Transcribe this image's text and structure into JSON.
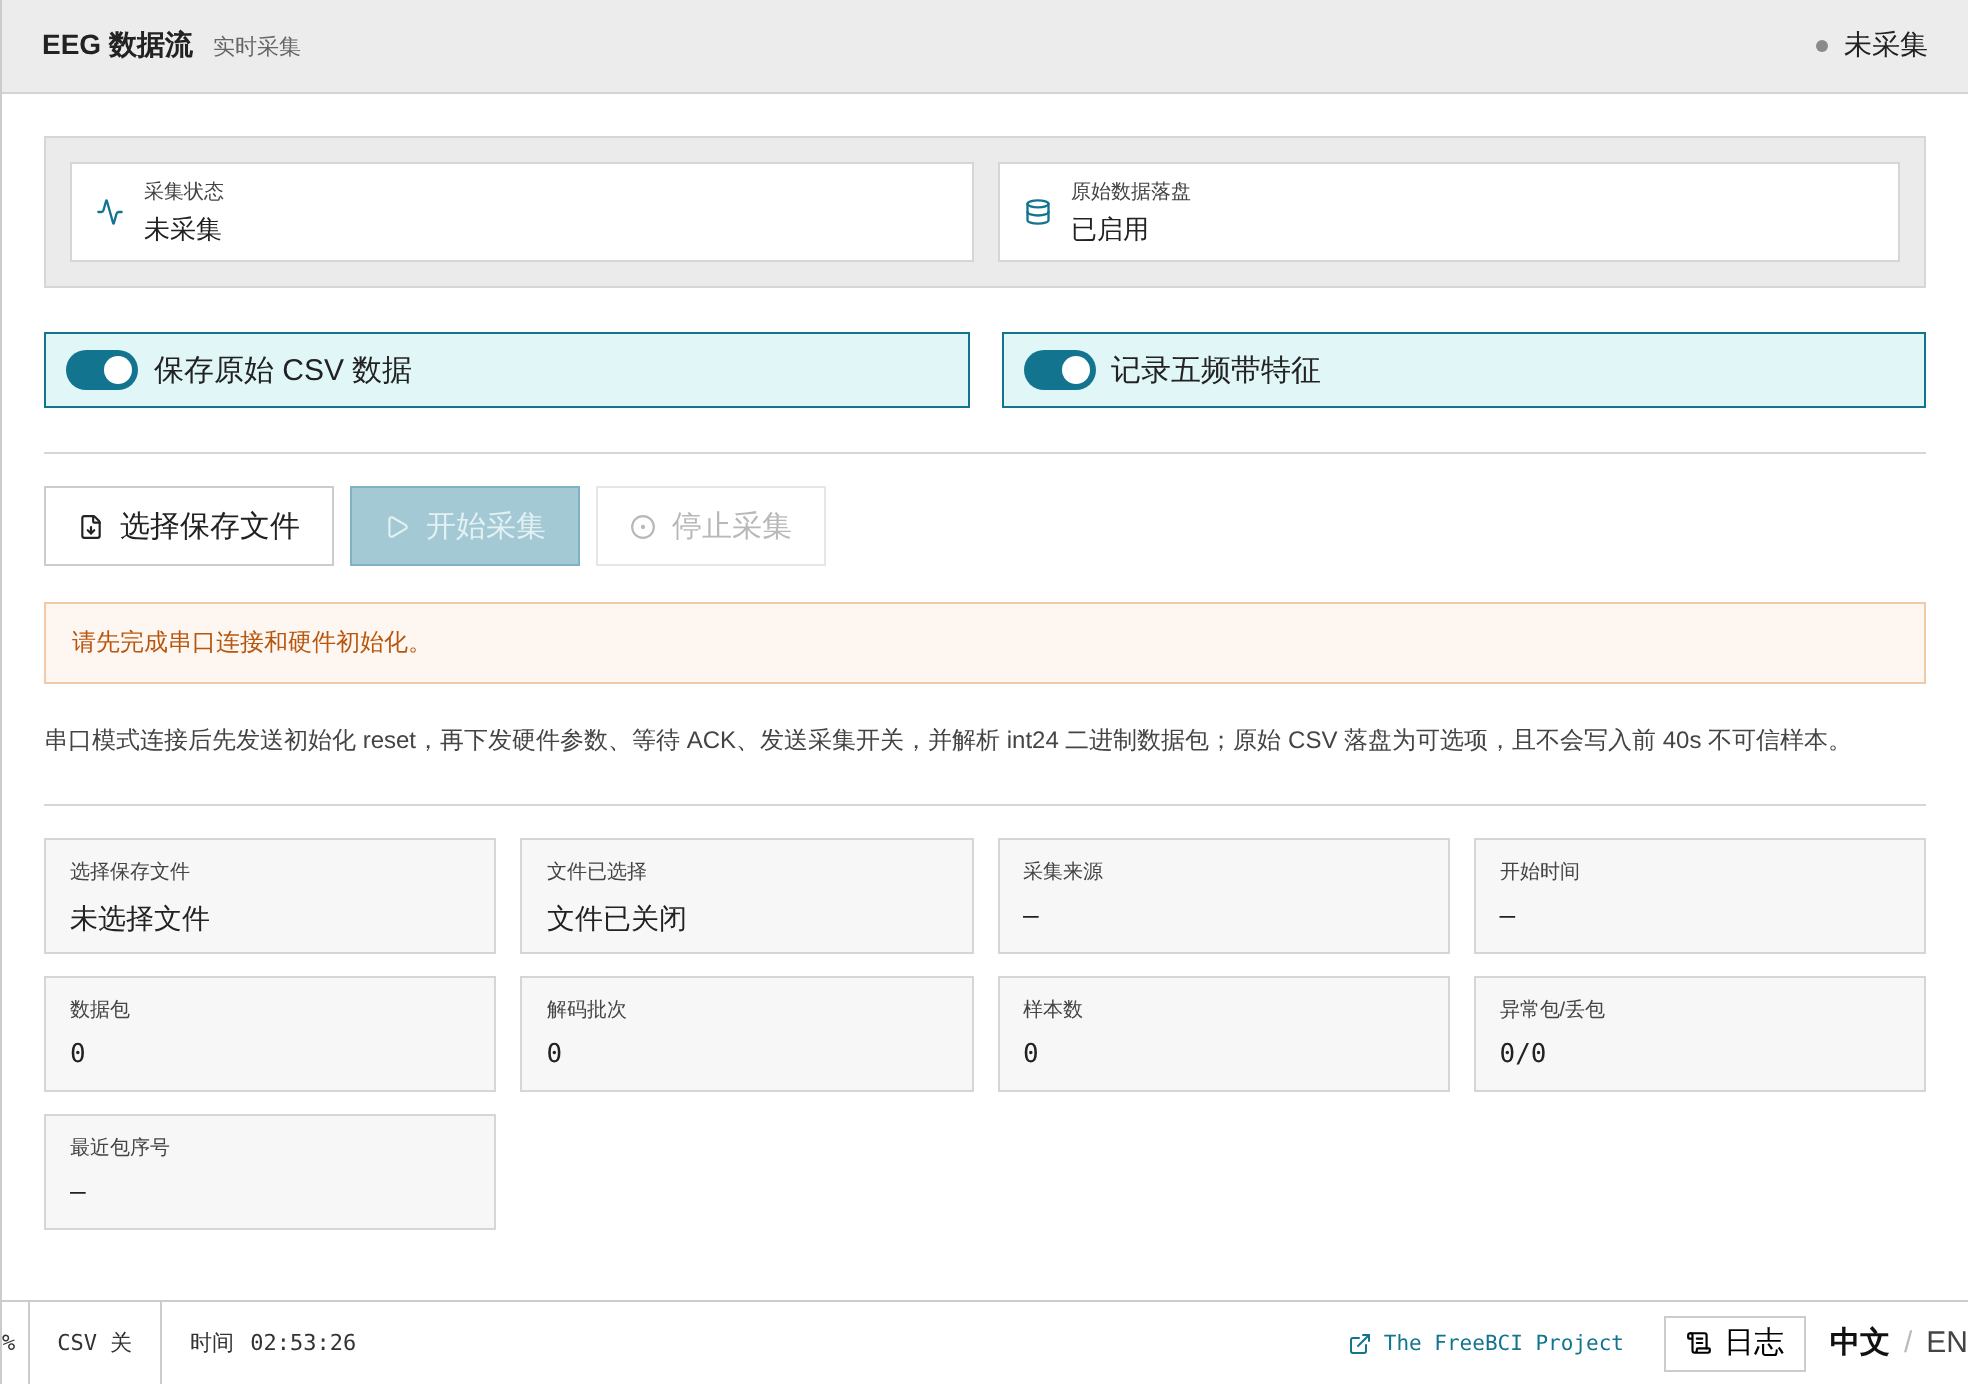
{
  "header": {
    "title": "EEG 数据流",
    "subtitle": "实时采集",
    "status": {
      "label": "未采集",
      "color": "#8a8a8a"
    }
  },
  "status_cards": [
    {
      "kind": "activity",
      "label": "采集状态",
      "value": "未采集"
    },
    {
      "kind": "database",
      "label": "原始数据落盘",
      "value": "已启用"
    }
  ],
  "toggles": [
    {
      "label": "保存原始 CSV 数据",
      "on": true
    },
    {
      "label": "记录五频带特征",
      "on": true
    }
  ],
  "buttons": [
    {
      "kind": "file",
      "label": "选择保存文件",
      "disabled": false,
      "primary": false
    },
    {
      "kind": "play",
      "label": "开始采集",
      "disabled": true,
      "primary": true
    },
    {
      "kind": "stop",
      "label": "停止采集",
      "disabled": true,
      "primary": false
    }
  ],
  "alert": "请先完成串口连接和硬件初始化。",
  "description": "串口模式连接后先发送初始化 reset，再下发硬件参数、等待 ACK、发送采集开关，并解析 int24 二进制数据包；原始 CSV 落盘为可选项，且不会写入前 40s 不可信样本。",
  "stats": [
    {
      "label": "选择保存文件",
      "value": "未选择文件",
      "mono": false
    },
    {
      "label": "文件已选择",
      "value": "文件已关闭",
      "mono": false
    },
    {
      "label": "采集来源",
      "value": "—",
      "mono": true
    },
    {
      "label": "开始时间",
      "value": "—",
      "mono": true
    },
    {
      "label": "数据包",
      "value": "0",
      "mono": true
    },
    {
      "label": "解码批次",
      "value": "0",
      "mono": true
    },
    {
      "label": "样本数",
      "value": "0",
      "mono": true
    },
    {
      "label": "异常包/丢包",
      "value": "0/0",
      "mono": true
    },
    {
      "label": "最近包序号",
      "value": "—",
      "mono": true
    }
  ],
  "status_bar": {
    "cut_item": "%",
    "csv": "CSV 关",
    "time_label": "时间",
    "time": "02:53:26",
    "link": "The FreeBCI Project",
    "log_button": "日志",
    "separator": "/",
    "languages": [
      {
        "label": "中文",
        "selected": true
      },
      {
        "label": "EN",
        "selected": false
      }
    ]
  }
}
